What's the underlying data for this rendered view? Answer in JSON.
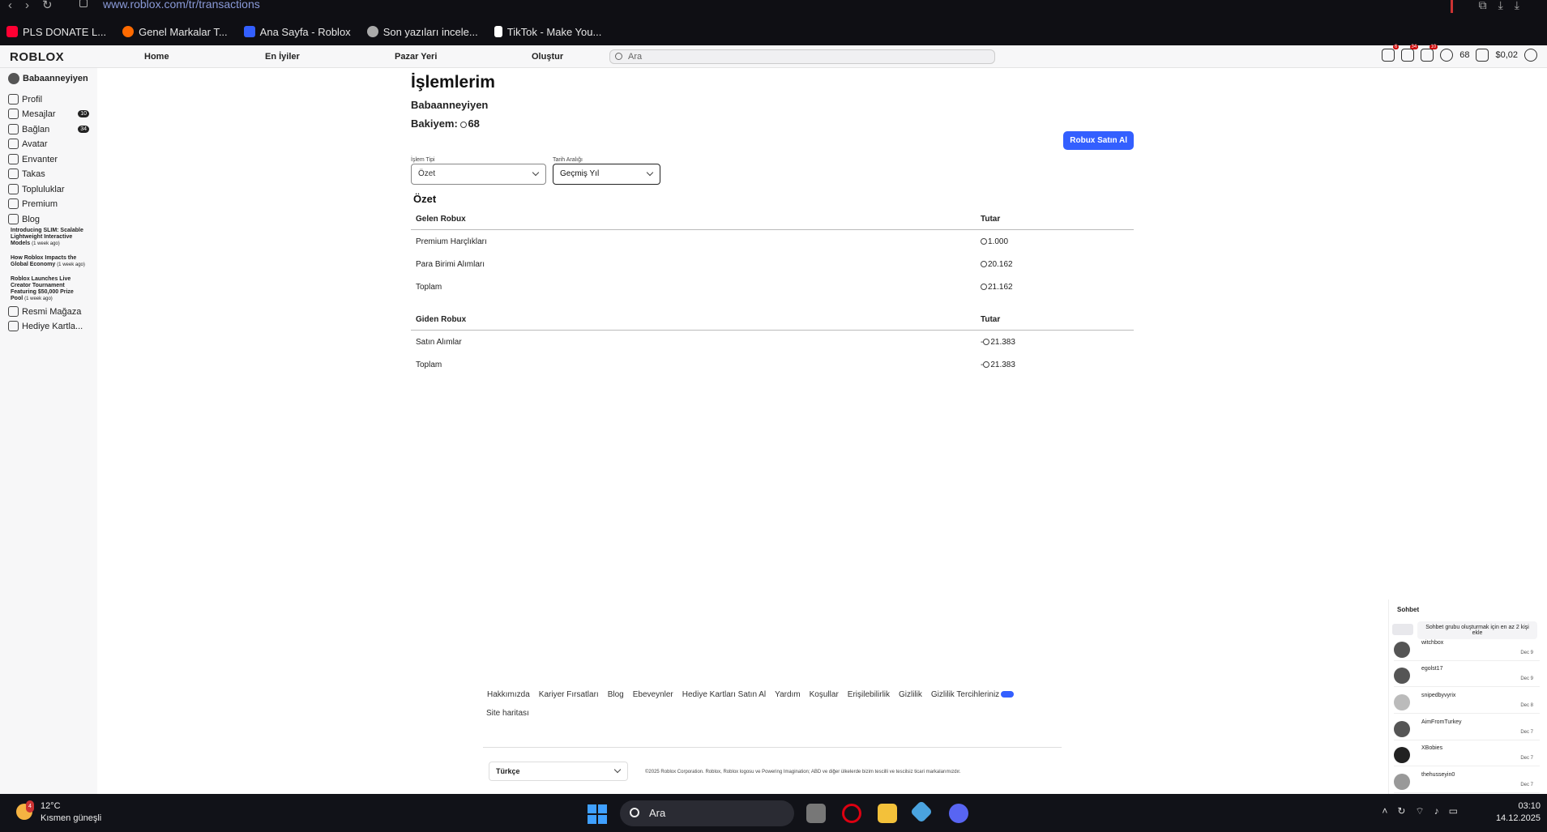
{
  "browser": {
    "url": "www.roblox.com/tr/transactions",
    "bookmarks": [
      {
        "label": "PLS DONATE L...",
        "color": "#ff0033"
      },
      {
        "label": "Genel Markalar T...",
        "color": "#ff6a00"
      },
      {
        "label": "Ana Sayfa - Roblox",
        "color": "#335fff"
      },
      {
        "label": "Son yazıları incele...",
        "color": "#aaaaaa"
      },
      {
        "label": "TikTok - Make You...",
        "color": "#ffffff"
      }
    ]
  },
  "header": {
    "logo": "ROBLOX",
    "nav": [
      "Home",
      "En İyiler",
      "Pazar Yeri",
      "Oluştur"
    ],
    "search_placeholder": "Ara",
    "notif_badges": [
      "6",
      "34",
      "10"
    ],
    "robux": "68",
    "credit": "$0,02"
  },
  "sidebar": {
    "username": "Babaanneyiyen",
    "items": [
      {
        "label": "Profil",
        "icon": "person-icon"
      },
      {
        "label": "Mesajlar",
        "icon": "message-icon",
        "badge": "10"
      },
      {
        "label": "Bağlan",
        "icon": "friends-icon",
        "badge": "34"
      },
      {
        "label": "Avatar",
        "icon": "avatar-icon"
      },
      {
        "label": "Envanter",
        "icon": "inventory-icon"
      },
      {
        "label": "Takas",
        "icon": "trade-icon"
      },
      {
        "label": "Topluluklar",
        "icon": "groups-icon"
      },
      {
        "label": "Premium",
        "icon": "premium-icon"
      },
      {
        "label": "Blog",
        "icon": "blog-icon"
      }
    ],
    "blog_posts": [
      {
        "title": "Introducing SLIM: Scalable Lightweight Interactive Models",
        "ago": "(1 week ago)"
      },
      {
        "title": "How Roblox Impacts the Global Economy",
        "ago": "(1 week ago)"
      },
      {
        "title": "Roblox Launches Live Creator Tournament Featuring $50,000 Prize Pool",
        "ago": "(1 week ago)"
      }
    ],
    "bottom_items": [
      {
        "label": "Resmi Mağaza",
        "icon": "cart-icon"
      },
      {
        "label": "Hediye Kartla...",
        "icon": "gift-card-icon"
      }
    ]
  },
  "main": {
    "title": "İşlemlerim",
    "username": "Babaanneyiyen",
    "balance_label": "Bakiyem:",
    "balance": "68",
    "buy_button": "Robux Satın Al",
    "filter_type_label": "İşlem Tipi",
    "filter_type_value": "Özet",
    "filter_date_label": "Tarih Aralığı",
    "filter_date_value": "Geçmiş Yıl",
    "summary_title": "Özet",
    "incoming": {
      "header": "Gelen Robux",
      "amount_header": "Tutar",
      "rows": [
        {
          "label": "Premium Harçlıkları",
          "amount": "1.000"
        },
        {
          "label": "Para Birimi Alımları",
          "amount": "20.162"
        },
        {
          "label": "Toplam",
          "amount": "21.162"
        }
      ]
    },
    "outgoing": {
      "header": "Giden Robux",
      "amount_header": "Tutar",
      "rows": [
        {
          "label": "Satın Alımlar",
          "amount": "21.383"
        },
        {
          "label": "Toplam",
          "amount": "21.383"
        }
      ]
    }
  },
  "footer": {
    "links": [
      "Hakkımızda",
      "Kariyer Fırsatları",
      "Blog",
      "Ebeveynler",
      "Hediye Kartları Satın Al",
      "Yardım",
      "Koşullar",
      "Erişilebilirlik",
      "Gizlilik",
      "Gizlilik Tercihleriniz"
    ],
    "sitemap": "Site haritası",
    "language": "Türkçe",
    "copyright": "©2025 Roblox Corporation. Roblox, Roblox logosu ve Powering Imagination; ABD ve diğer ülkelerde bizim tescilli ve tescilsiz ticari markalarımızdır."
  },
  "chat": {
    "title": "Sohbet",
    "tip": "Sohbet grubu oluşturmak için en az 2 kişi ekle",
    "rows": [
      {
        "name": "witchbox",
        "date": "Dec 9"
      },
      {
        "name": "egolst17",
        "date": "Dec 9"
      },
      {
        "name": "snipedbyvyrix",
        "date": "Dec 8"
      },
      {
        "name": "AimFromTurkey",
        "date": "Dec 7"
      },
      {
        "name": "XBobies",
        "date": "Dec 7"
      },
      {
        "name": "thehusseyin0",
        "date": "Dec 7"
      }
    ]
  },
  "taskbar": {
    "weather_badge": "4",
    "temperature": "12°C",
    "condition": "Kısmen güneşli",
    "search": "Ara",
    "time": "03:10",
    "date": "14.12.2025"
  }
}
